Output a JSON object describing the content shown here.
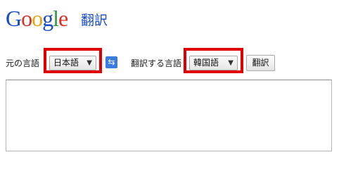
{
  "header": {
    "logo_letters": [
      "G",
      "o",
      "o",
      "g",
      "l",
      "e"
    ],
    "product_name": "翻訳"
  },
  "toolbar": {
    "source_label": "元の言語",
    "source_value": "日本語",
    "target_label": "翻訳する言語",
    "target_value": "韓国語",
    "translate_button": "翻訳"
  },
  "icons": {
    "dropdown": "chevron-down-icon",
    "swap": "swap-languages-icon"
  },
  "colors": {
    "highlight": "#e00000",
    "brand_blue": "#1a4bc4",
    "swap_bg": "#3a7de0"
  },
  "input": {
    "value": ""
  }
}
